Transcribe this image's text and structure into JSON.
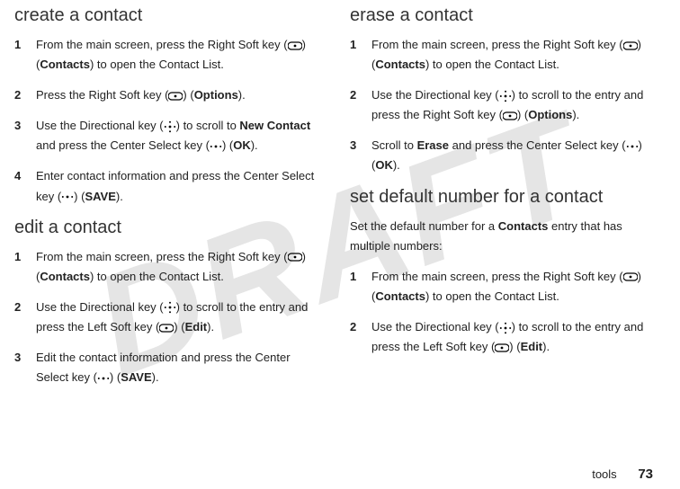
{
  "watermark": "DRAFT",
  "footer": {
    "section": "tools",
    "page": "73"
  },
  "icons": {
    "softkey": "softkey-icon",
    "directional": "directional-key-icon",
    "center": "center-select-icon"
  },
  "left": {
    "h1": "create a contact",
    "s1": {
      "n": "1",
      "a": "From the main screen, press the Right Soft key (",
      "b": ") (",
      "c": "Contacts",
      "d": ") to open the Contact List."
    },
    "s2": {
      "n": "2",
      "a": "Press the Right Soft key (",
      "b": ") (",
      "c": "Options",
      "d": ")."
    },
    "s3": {
      "n": "3",
      "a": "Use the Directional key (",
      "b": ") to scroll to ",
      "c": "New Contact",
      "d": " and press the Center Select key (",
      "e": ") (",
      "f": "OK",
      "g": ")."
    },
    "s4": {
      "n": "4",
      "a": "Enter contact information and press the Center Select key (",
      "b": ") (",
      "c": "SAVE",
      "d": ")."
    },
    "h2": "edit a contact",
    "e1": {
      "n": "1",
      "a": "From the main screen, press the Right Soft key (",
      "b": ") (",
      "c": "Contacts",
      "d": ") to open the Contact List."
    },
    "e2": {
      "n": "2",
      "a": "Use the Directional key (",
      "b": ") to scroll to the entry and press the Left Soft key (",
      "c": ") (",
      "d": "Edit",
      "e": ")."
    },
    "e3": {
      "n": "3",
      "a": "Edit the contact information and press the Center Select key (",
      "b": ") (",
      "c": "SAVE",
      "d": ")."
    }
  },
  "right": {
    "h1": "erase a contact",
    "r1": {
      "n": "1",
      "a": "From the main screen, press the Right Soft key (",
      "b": ") (",
      "c": "Contacts",
      "d": ") to open the Contact List."
    },
    "r2": {
      "n": "2",
      "a": "Use the Directional key (",
      "b": ") to scroll to the entry and press the Right Soft key (",
      "c": ") (",
      "d": "Options",
      "e": ")."
    },
    "r3": {
      "n": "3",
      "a": "Scroll to ",
      "b": "Erase",
      "c": " and press the Center Select key (",
      "d": ") (",
      "e": "OK",
      "f": ")."
    },
    "h2": "set default number for a contact",
    "p1a": "Set the default number for a ",
    "p1b": "Contacts",
    "p1c": " entry that has multiple numbers:",
    "d1": {
      "n": "1",
      "a": "From the main screen, press the Right Soft key (",
      "b": ") (",
      "c": "Contacts",
      "d": ") to open the Contact List."
    },
    "d2": {
      "n": "2",
      "a": "Use the Directional key (",
      "b": ") to scroll to the entry and press the Left Soft key (",
      "c": ") (",
      "d": "Edit",
      "e": ")."
    }
  }
}
